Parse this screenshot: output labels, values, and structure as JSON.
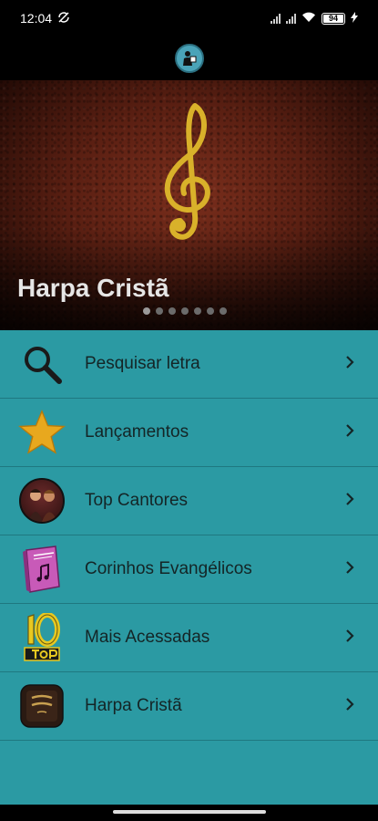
{
  "status_bar": {
    "time": "12:04",
    "battery": "94"
  },
  "banner": {
    "title": "Harpa Cristã",
    "dot_count": 7
  },
  "menu": {
    "items": [
      {
        "label": "Pesquisar letra",
        "icon": "search-icon"
      },
      {
        "label": "Lançamentos",
        "icon": "star-icon"
      },
      {
        "label": "Top Cantores",
        "icon": "singers-thumbnail"
      },
      {
        "label": "Corinhos Evangélicos",
        "icon": "songbook-icon"
      },
      {
        "label": "Mais Acessadas",
        "icon": "top10-icon"
      },
      {
        "label": "Harpa Cristã",
        "icon": "harpa-book-icon"
      }
    ]
  },
  "colors": {
    "menu_bg": "#2b9aa3",
    "divider": "#1f7880",
    "clef_gold": "#d9b12a",
    "star_gold": "#e8a81e"
  }
}
